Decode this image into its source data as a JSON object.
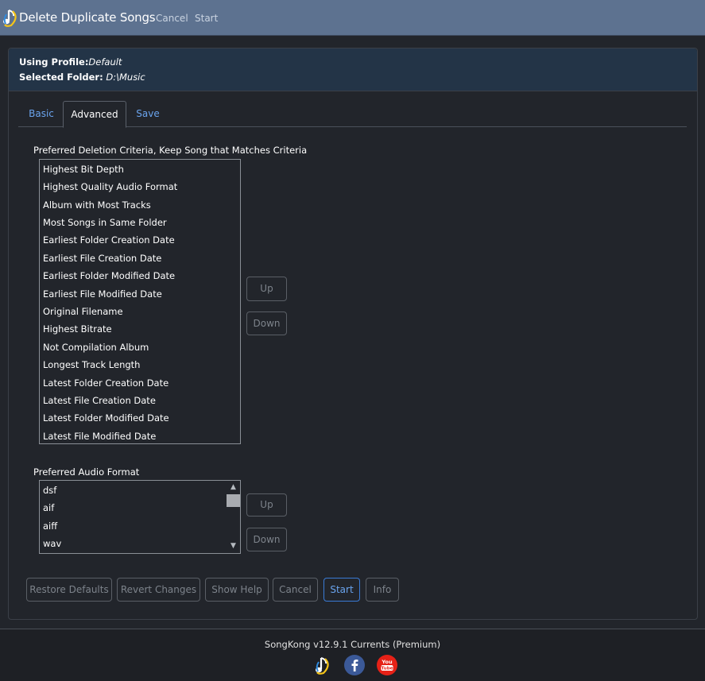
{
  "header": {
    "title": "Delete Duplicate Songs",
    "cancel_label": "Cancel",
    "start_label": "Start"
  },
  "profile": {
    "using_label": "Using Profile:",
    "using_value": "Default",
    "folder_label": "Selected Folder:",
    "folder_value": "D:\\Music"
  },
  "tabs": [
    {
      "label": "Basic",
      "active": false
    },
    {
      "label": "Advanced",
      "active": true
    },
    {
      "label": "Save",
      "active": false
    }
  ],
  "criteria": {
    "label": "Preferred Deletion Criteria, Keep Song that Matches Criteria",
    "items": [
      "Highest Bit Depth",
      "Highest Quality Audio Format",
      "Album with Most Tracks",
      "Most Songs in Same Folder",
      "Earliest Folder Creation Date",
      "Earliest File Creation Date",
      "Earliest Folder Modified Date",
      "Earliest File Modified Date",
      "Original Filename",
      "Highest Bitrate",
      "Not Compilation Album",
      "Longest Track Length",
      "Latest Folder Creation Date",
      "Latest File Creation Date",
      "Latest Folder Modified Date",
      "Latest File Modified Date"
    ],
    "up_label": "Up",
    "down_label": "Down"
  },
  "audio_format": {
    "label": "Preferred Audio Format",
    "items": [
      "dsf",
      "aif",
      "aiff",
      "wav"
    ],
    "up_label": "Up",
    "down_label": "Down"
  },
  "actions": {
    "restore_defaults": "Restore Defaults",
    "revert_changes": "Revert Changes",
    "show_help": "Show Help",
    "cancel": "Cancel",
    "start": "Start",
    "info": "Info"
  },
  "footer": {
    "version": "SongKong v12.9.1 Currents (Premium)",
    "icons": [
      "songkong-logo-icon",
      "facebook-icon",
      "youtube-icon"
    ]
  },
  "colors": {
    "header_bg": "#5d7290",
    "panel_head_bg": "#233447",
    "link": "#6aa4ee",
    "primary_border": "#3a7bd5",
    "facebook": "#3b5998",
    "youtube": "#e62117"
  }
}
